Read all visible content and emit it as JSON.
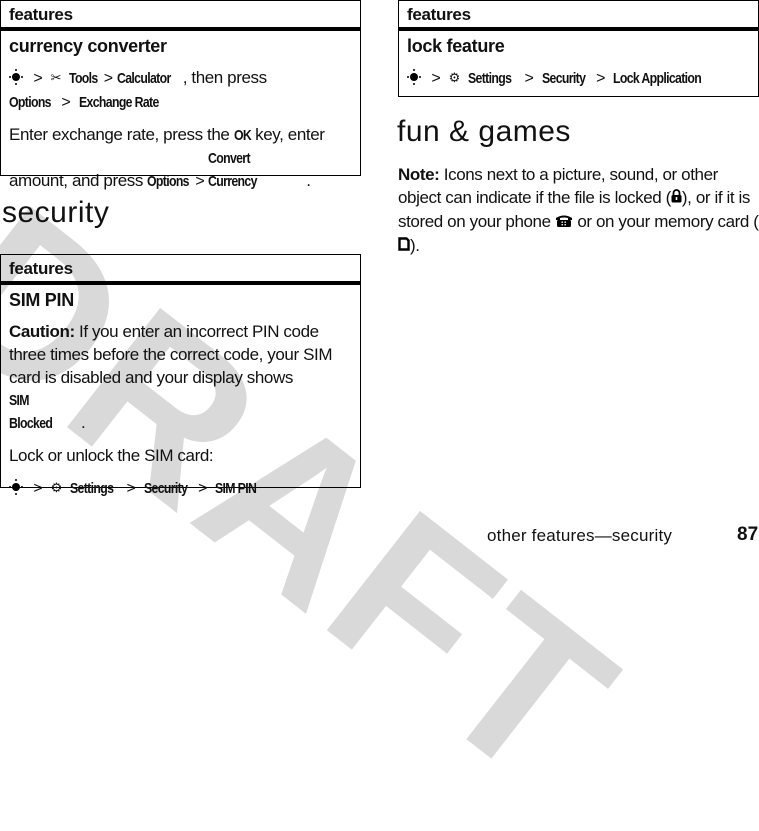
{
  "watermark": "DRAFT",
  "left_column": {
    "table1": {
      "header": "features",
      "title": "currency converter",
      "path_line": {
        "icons": [
          "nav-key-icon",
          "tools-icon"
        ],
        "items": [
          "Tools",
          "Calculator"
        ],
        "suffix": ", then press",
        "items2": [
          "Options",
          "Exchange Rate"
        ]
      },
      "para2": {
        "t1": "Enter exchange rate, press the ",
        "k1": "OK",
        "t2": " key, enter amount, and press ",
        "k2": "Options",
        "k3": "Convert Currency",
        "t3": "."
      }
    },
    "section_heading": "security",
    "table2": {
      "header": "features",
      "title": "SIM PIN",
      "caution_label": "Caution:",
      "caution_text": " If you enter an incorrect PIN code three times before the correct code, your SIM card is disabled and your display shows ",
      "caution_ui": "SIM Blocked",
      "caution_end": ".",
      "lock_text": "Lock or unlock the SIM card:",
      "path": [
        "Settings",
        "Security",
        "SIM PIN"
      ]
    }
  },
  "right_column": {
    "table3": {
      "header": "features",
      "title": "lock feature",
      "path": [
        "Settings",
        "Security",
        "Lock Application"
      ]
    },
    "section_heading": "fun & games",
    "note": {
      "label": "Note:",
      "t1": " Icons next to a picture, sound, or other object can indicate if the file is locked (",
      "t2": "), or if it is stored on your phone ",
      "t3": " or on your memory card (",
      "t4": ")."
    }
  },
  "footer": {
    "section": "other features—security",
    "page_number": "87"
  },
  "glyphs": {
    "gt": ">",
    "tools": "✂",
    "settings": "⚙",
    "lock": "🔒",
    "phone": "☎",
    "card": "□"
  }
}
